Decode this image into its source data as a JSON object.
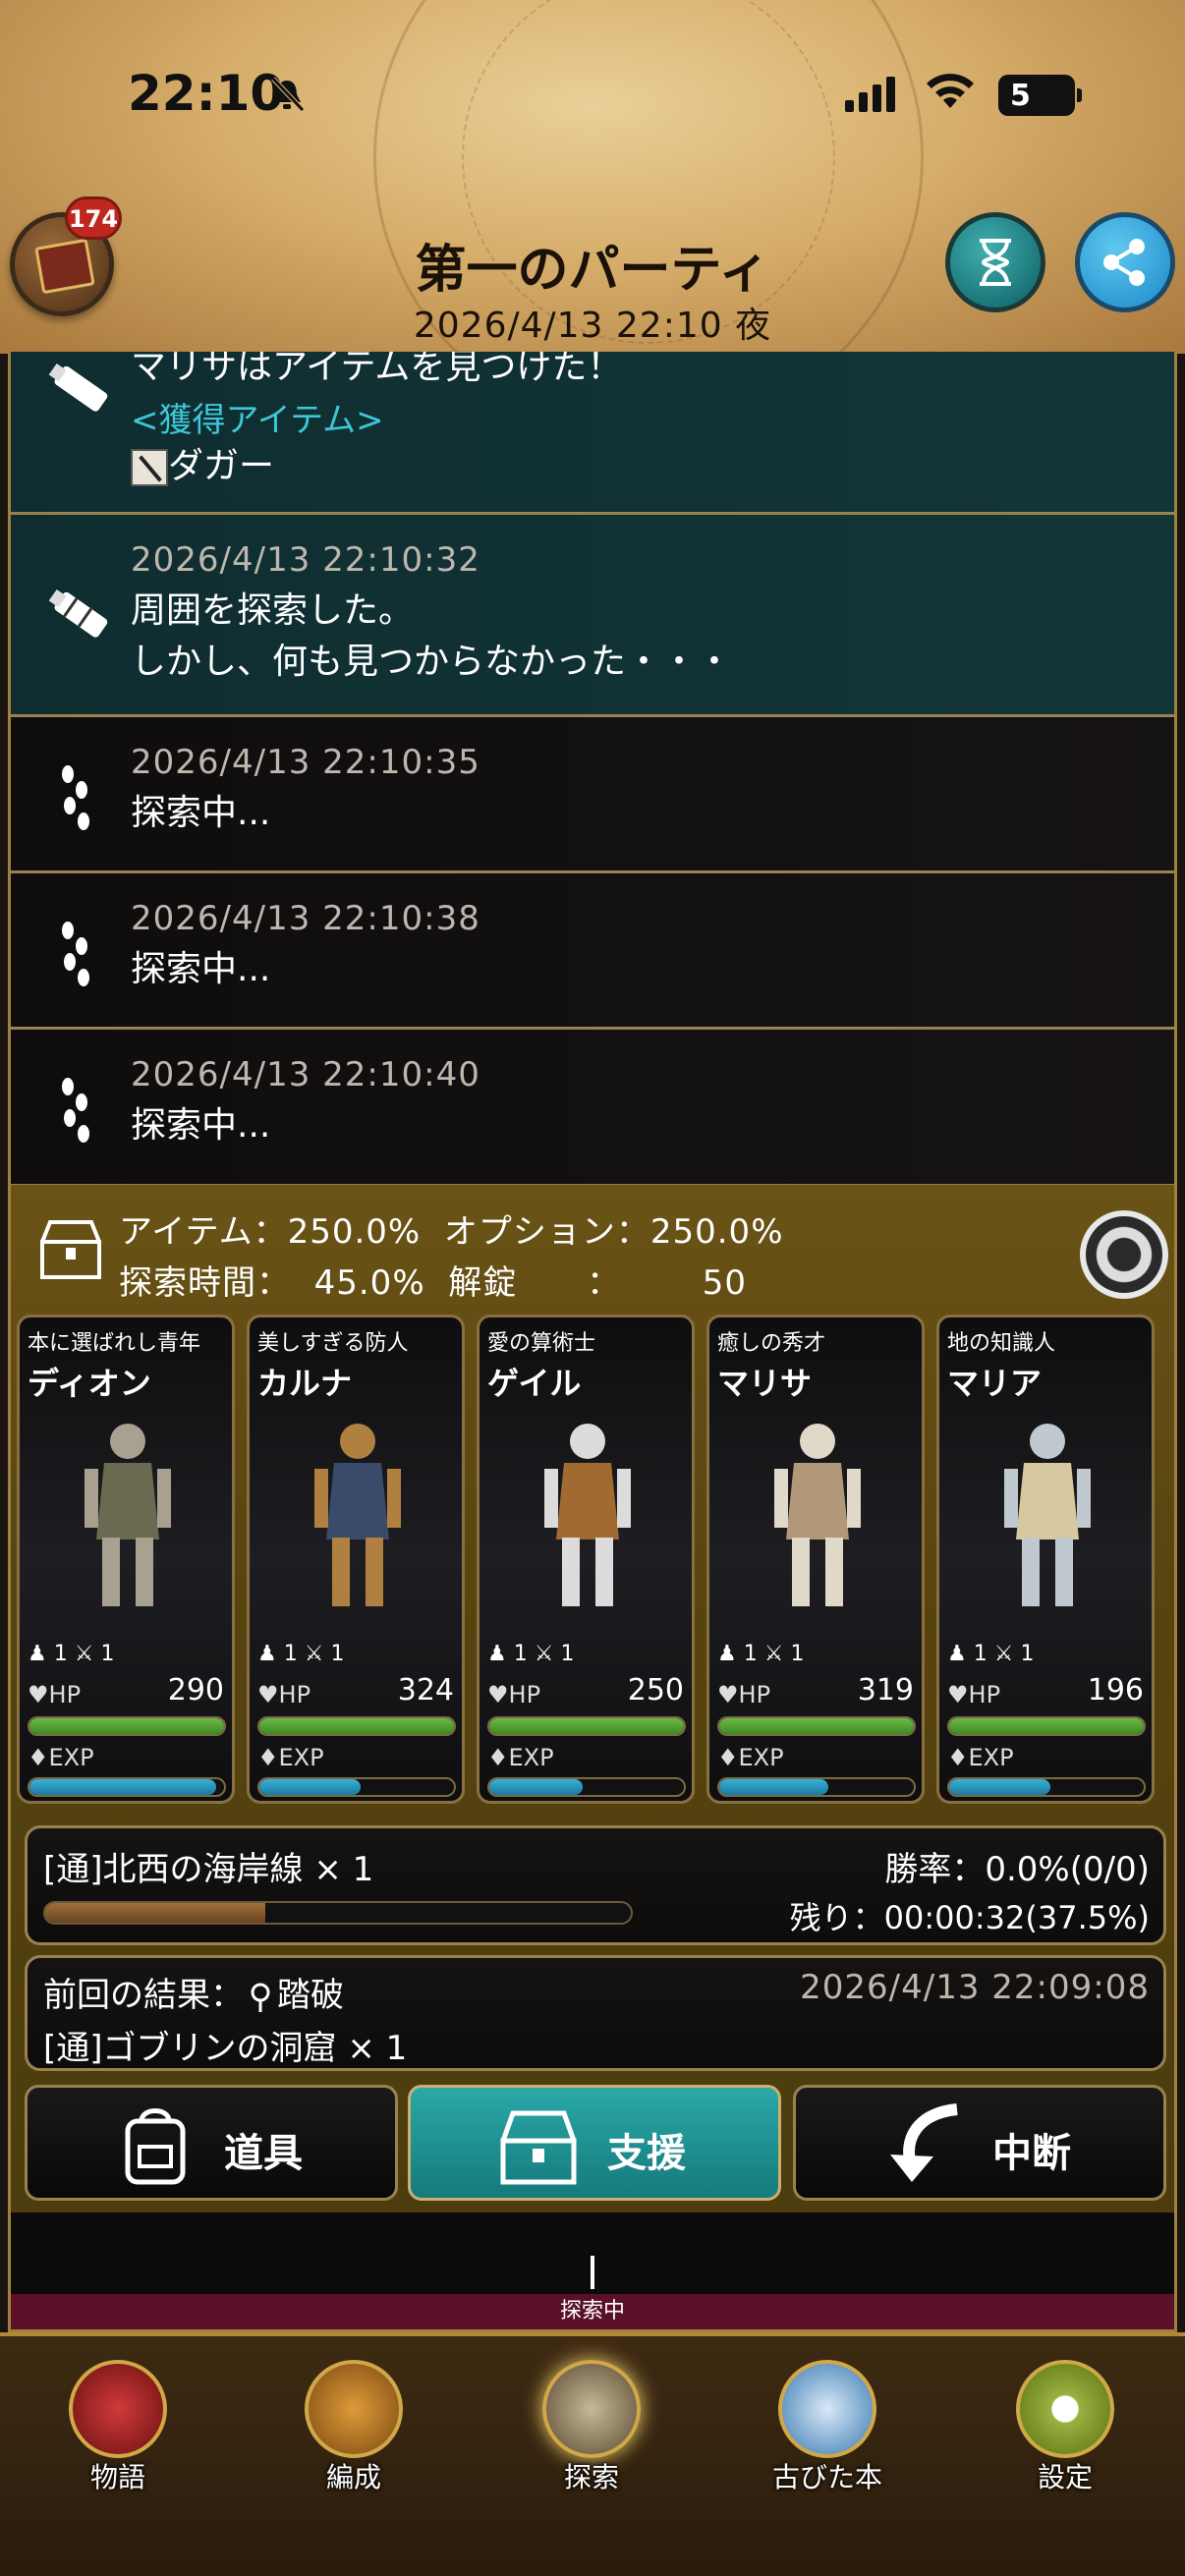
{
  "status_bar": {
    "time": "22:10",
    "battery": "5"
  },
  "header": {
    "badge_count": "174",
    "title": "第一のパーティ",
    "datetime": "2026/4/13  22:10  夜"
  },
  "log": {
    "entries": [
      {
        "type": "found",
        "message_top": "マリサはアイテムを見つけた！",
        "acquired_label": "<獲得アイテム>",
        "item": "ダガー"
      },
      {
        "type": "search",
        "timestamp": "2026/4/13  22:10:32",
        "line1": "周囲を探索した。",
        "line2": "しかし、何も見つからなかった・・・"
      },
      {
        "type": "walk",
        "timestamp": "2026/4/13  22:10:35",
        "line1": "探索中..."
      },
      {
        "type": "walk",
        "timestamp": "2026/4/13  22:10:38",
        "line1": "探索中..."
      },
      {
        "type": "walk",
        "timestamp": "2026/4/13  22:10:40",
        "line1": "探索中..."
      }
    ]
  },
  "bonus": {
    "line1": "アイテム：250.0%  オプション：250.0%",
    "line2": "探索時間：  45.0%  解錠      ：       50"
  },
  "characters": [
    {
      "title": "本に選ばれし青年",
      "name": "ディオン",
      "stat_a": "1",
      "stat_b": "1",
      "hp_label": "HP",
      "hp": "290",
      "hp_pct": 100,
      "exp_label": "EXP",
      "exp_pct": 96,
      "colors": [
        "#a8a090",
        "#6a6a50"
      ]
    },
    {
      "title": "美しすぎる防人",
      "name": "カルナ",
      "stat_a": "1",
      "stat_b": "1",
      "hp_label": "HP",
      "hp": "324",
      "hp_pct": 100,
      "exp_label": "EXP",
      "exp_pct": 52,
      "colors": [
        "#b08040",
        "#3a4a6a"
      ]
    },
    {
      "title": "愛の算術士",
      "name": "ゲイル",
      "stat_a": "1",
      "stat_b": "1",
      "hp_label": "HP",
      "hp": "250",
      "hp_pct": 100,
      "exp_label": "EXP",
      "exp_pct": 48,
      "colors": [
        "#dcdcdc",
        "#a06a30"
      ]
    },
    {
      "title": "癒しの秀才",
      "name": "マリサ",
      "stat_a": "1",
      "stat_b": "1",
      "hp_label": "HP",
      "hp": "319",
      "hp_pct": 100,
      "exp_label": "EXP",
      "exp_pct": 56,
      "colors": [
        "#e0d8c8",
        "#b09878"
      ]
    },
    {
      "title": "地の知識人",
      "name": "マリア",
      "stat_a": "1",
      "stat_b": "1",
      "hp_label": "HP",
      "hp": "196",
      "hp_pct": 100,
      "exp_label": "EXP",
      "exp_pct": 52,
      "colors": [
        "#c0c8d0",
        "#d8c8a0"
      ]
    }
  ],
  "quest": {
    "name": "[通]北西の海岸線  × 1",
    "winrate": "勝率：0.0%(0/0)",
    "remaining": "残り：00:00:32(37.5%)",
    "progress_pct": 37.5
  },
  "last_result": {
    "label": "前回の結果：",
    "outcome": "踏破",
    "date": "2026/4/13  22:09:08",
    "quest": "[通]ゴブリンの洞窟  × 1"
  },
  "actions": {
    "tools": "道具",
    "support": "支援",
    "abort": "中断"
  },
  "explore_status": "探索中",
  "nav": {
    "story": "物語",
    "formation": "編成",
    "explore": "探索",
    "old_book": "古びた本",
    "settings": "設定"
  },
  "colors": {
    "accent_teal": "#2aa8a8",
    "gold_border": "#9a8250",
    "hp_green": "#3c8a22",
    "exp_blue": "#1a7aa0"
  }
}
